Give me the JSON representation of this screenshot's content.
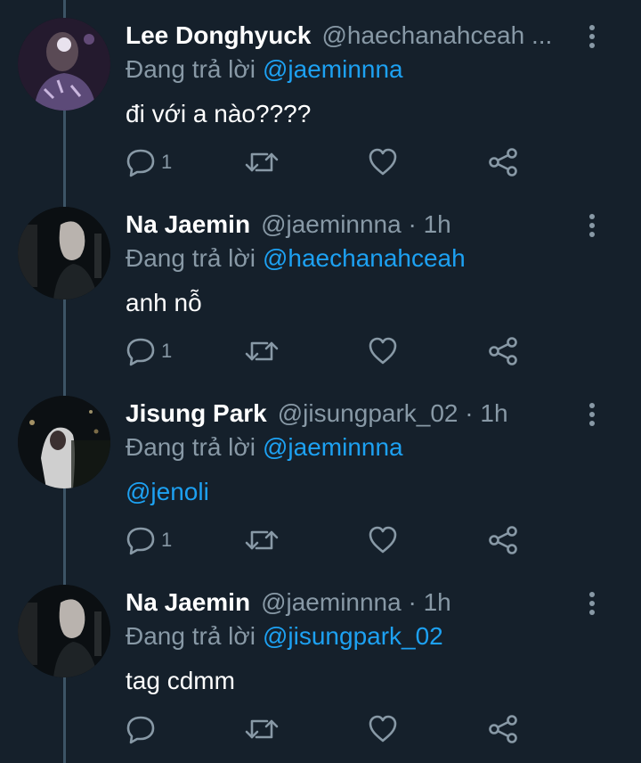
{
  "tweets": [
    {
      "name": "Lee Donghyuck",
      "handle": "@haechanahceah ...",
      "reply_prefix": "Đang trả lời",
      "reply_to": "@jaeminnna",
      "text": "đi với a nào????",
      "text_is_link": false,
      "reply_count": "1"
    },
    {
      "name": "Na Jaemin",
      "handle": "@jaeminnna · 1h",
      "reply_prefix": "Đang trả lời",
      "reply_to": "@haechanahceah",
      "text": "anh nỗ",
      "text_is_link": false,
      "reply_count": "1"
    },
    {
      "name": "Jisung Park",
      "handle": "@jisungpark_02 · 1h",
      "reply_prefix": "Đang trả lời",
      "reply_to": "@jaeminnna",
      "text": "@jenoli",
      "text_is_link": true,
      "reply_count": "1"
    },
    {
      "name": "Na Jaemin",
      "handle": "@jaeminnna · 1h",
      "reply_prefix": "Đang trả lời",
      "reply_to": "@jisungpark_02",
      "text": "tag cdmm",
      "text_is_link": false,
      "reply_count": ""
    }
  ],
  "icons": {
    "reply": "reply-icon",
    "retweet": "retweet-icon",
    "like": "like-icon",
    "share": "share-icon",
    "more": "more-vertical-icon"
  },
  "colors": {
    "background": "#15202b",
    "text": "#ffffff",
    "secondary": "#8899a6",
    "accent": "#1da1f2",
    "thread_line": "#3d5466"
  }
}
